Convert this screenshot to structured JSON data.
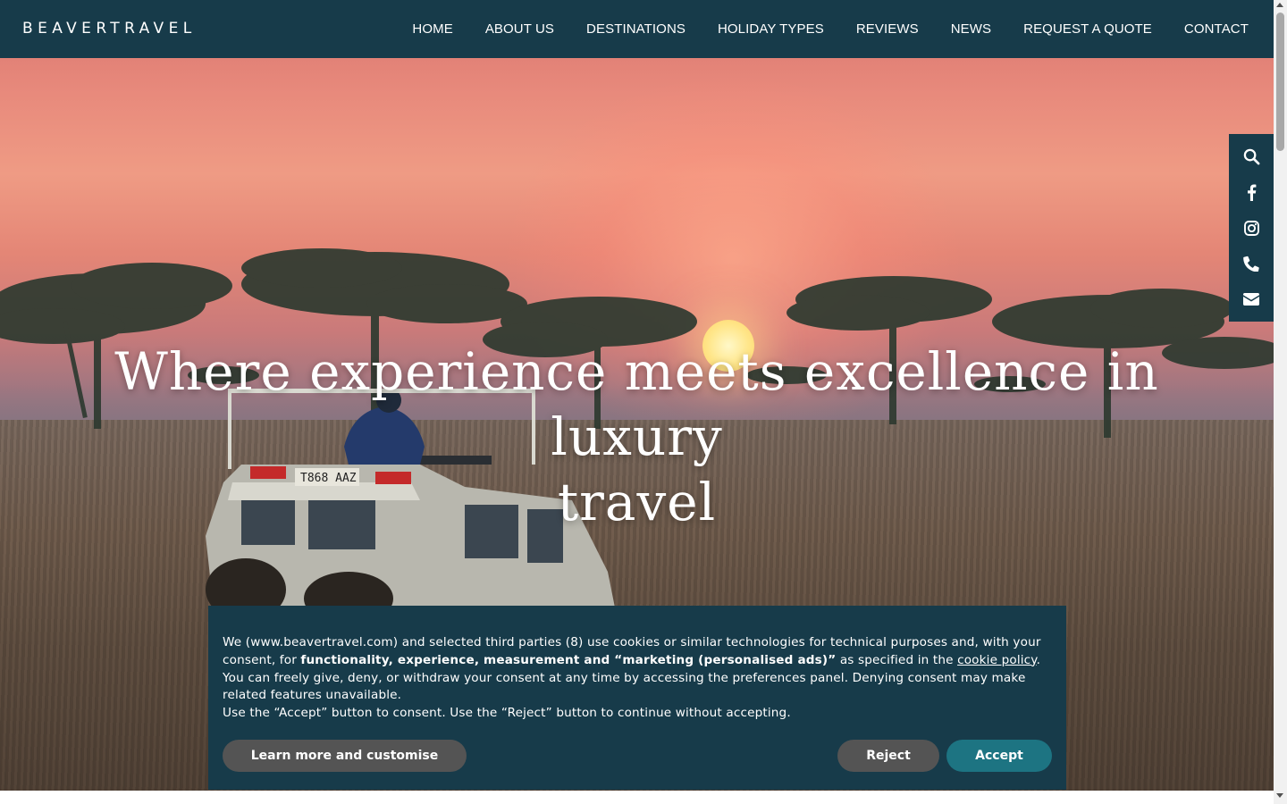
{
  "brand": {
    "logo_text": "BEAVERTRAVEL"
  },
  "nav": {
    "items": [
      {
        "label": "HOME"
      },
      {
        "label": "ABOUT US"
      },
      {
        "label": "DESTINATIONS"
      },
      {
        "label": "HOLIDAY TYPES"
      },
      {
        "label": "REVIEWS"
      },
      {
        "label": "NEWS"
      },
      {
        "label": "REQUEST A QUOTE"
      },
      {
        "label": "CONTACT"
      }
    ]
  },
  "sidebar": {
    "icons": [
      "search-icon",
      "facebook-icon",
      "instagram-icon",
      "phone-icon",
      "email-icon"
    ]
  },
  "hero": {
    "headline_line1": "Where experience meets excellence in luxury",
    "headline_line2": "travel",
    "vehicle_plate": "T868 AAZ"
  },
  "cookie_banner": {
    "text_part1": "We (www.beavertravel.com) and selected third parties (8) use cookies or similar technologies for technical purposes and, with your consent, for ",
    "text_bold": "functionality, experience, measurement and “marketing (personalised ads)”",
    "text_part2": " as specified in the ",
    "policy_link": "cookie policy",
    "text_part3": ".",
    "text_line2": "You can freely give, deny, or withdraw your consent at any time by accessing the preferences panel. Denying consent may make related features unavailable.",
    "text_line3": "Use the “Accept” button to consent. Use the “Reject” button to continue without accepting.",
    "learn_label": "Learn more and customise",
    "reject_label": "Reject",
    "accept_label": "Accept"
  },
  "colors": {
    "brand_navy": "#173b4a",
    "accept_teal": "#1d7482",
    "button_gray": "#545454"
  }
}
